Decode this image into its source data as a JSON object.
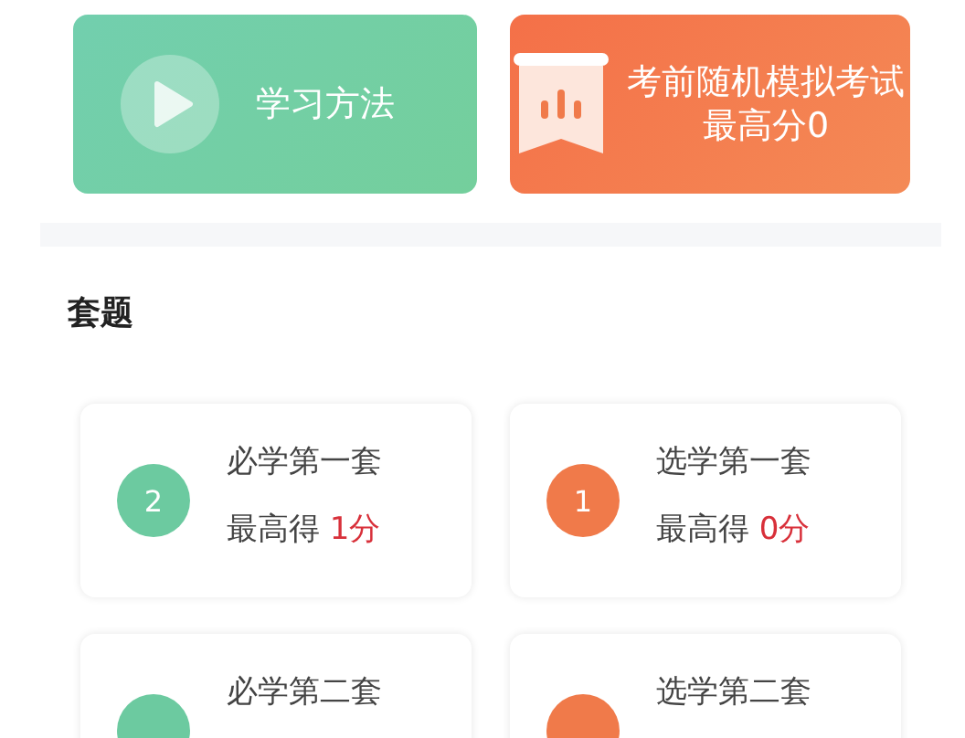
{
  "shortcuts": [
    {
      "kind": "play",
      "title": "学习方法"
    },
    {
      "kind": "exam",
      "title": "考前随机模拟考试",
      "subtitle": "最高分0"
    }
  ],
  "section_title": "套题",
  "sets": [
    {
      "number": "2",
      "color": "#6ccaa0",
      "name": "必学第一套",
      "score_label": "最高得",
      "score": "1分"
    },
    {
      "number": "1",
      "color": "#f07a4a",
      "name": "选学第一套",
      "score_label": "最高得",
      "score": "0分"
    },
    {
      "color": "#6ccaa0",
      "name": "必学第二套"
    },
    {
      "color": "#f07a4a",
      "name": "选学第二套"
    }
  ]
}
